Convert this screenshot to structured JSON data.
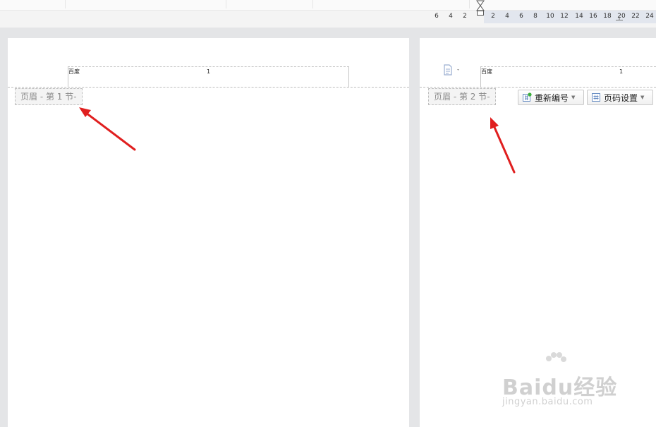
{
  "ruler": {
    "numbers": [
      "6",
      "4",
      "2",
      "2",
      "4",
      "6",
      "8",
      "10",
      "12",
      "14",
      "16",
      "18",
      "20",
      "22",
      "24"
    ]
  },
  "page1": {
    "header_left_cell": "百度",
    "header_right_cell": "1",
    "section_label": "页眉 - 第 1 节-"
  },
  "page2": {
    "header_left_cell": "百度",
    "header_right_cell": "1",
    "section_label": "页眉 - 第 2 节-",
    "renumber_button": "重新编号",
    "page_setting_button": "页码设置"
  },
  "watermark": {
    "brand": "Baidu经验",
    "url": "jingyan.baidu.com"
  },
  "colors": {
    "arrow": "#e01f1f",
    "label_bg": "#f4f4f4",
    "page_bg": "#ffffff"
  }
}
